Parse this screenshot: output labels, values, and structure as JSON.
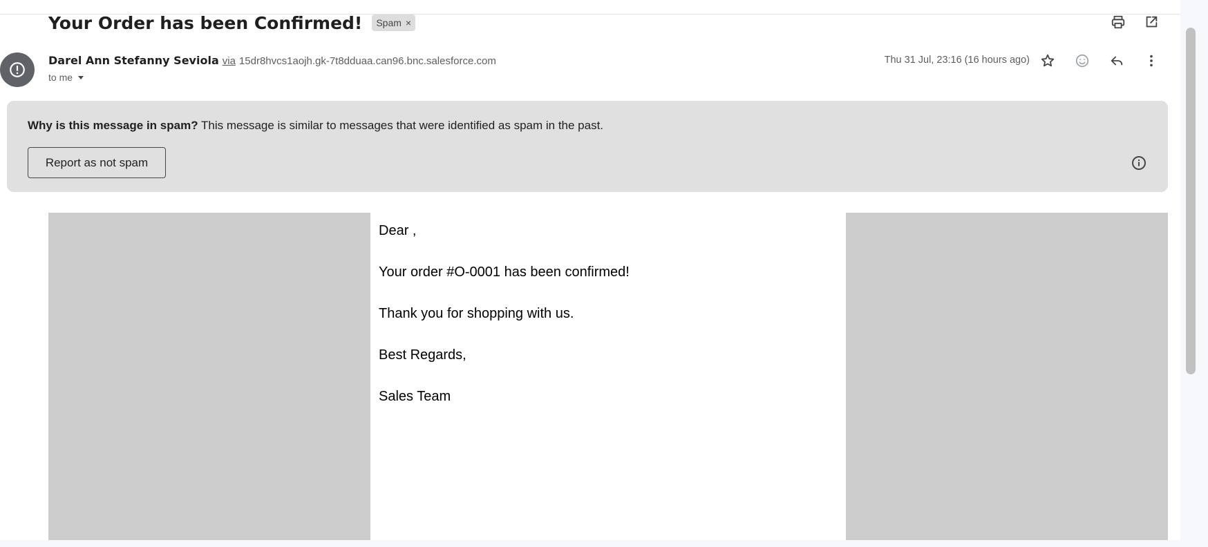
{
  "email": {
    "subject": "Your Order has been Confirmed!",
    "label_chip": "Spam",
    "label_chip_remove": "×",
    "sender_name": "Darel Ann Stefanny Seviola",
    "via_label": "via",
    "via_domain": "15dr8hvcs1aojh.gk-7t8dduaa.can96.bnc.salesforce.com",
    "recipient": "to me",
    "timestamp": "Thu 31 Jul, 23:16 (16 hours ago)"
  },
  "spam_notice": {
    "question": "Why is this message in spam?",
    "explanation": "This message is similar to messages that were identified as spam in the past.",
    "button_label": "Report as not spam"
  },
  "message_body": {
    "lines": [
      "Dear ,",
      "Your order #O-0001 has been confirmed!",
      "Thank you for shopping with us.",
      "Best Regards,",
      "Sales Team"
    ]
  },
  "icons": {
    "print": "print-icon",
    "open_new_window": "open-in-new-window-icon",
    "avatar": "spam-warning-icon",
    "dropdown": "caret-down-icon",
    "star": "star-icon",
    "emoji": "emoji-reaction-icon",
    "reply": "reply-icon",
    "more": "more-vertical-icon",
    "info": "info-icon"
  },
  "colors": {
    "banner_background": "#e0e0e0",
    "avatar_background": "#5f6368",
    "image_placeholder": "#cccccc"
  }
}
